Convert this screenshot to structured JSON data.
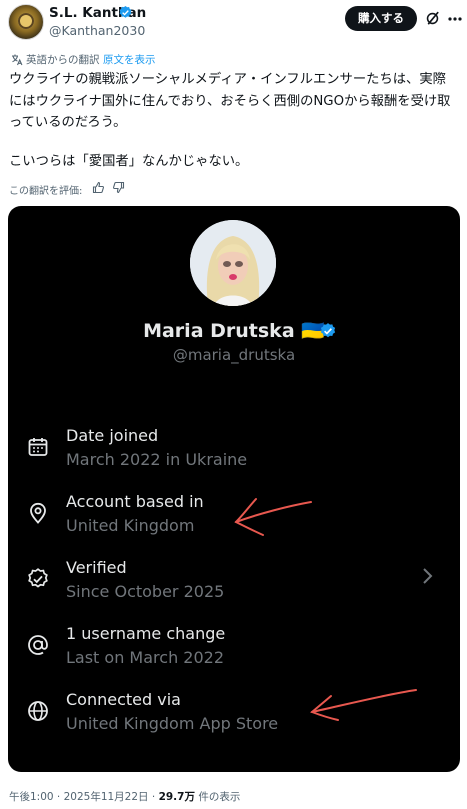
{
  "author": {
    "name": "S.L. Kanthan",
    "handle": "@Kanthan2030",
    "verified_color": "#1d9bf0"
  },
  "header": {
    "buy_label": "購入する",
    "icons": [
      "grok-icon",
      "more-icon"
    ]
  },
  "translation": {
    "label": "英語からの翻訳",
    "show_original": "原文を表示"
  },
  "tweet": {
    "text_line1": "ウクライナの親戦派ソーシャルメディア・インフルエンサーたちは、実際にはウクライナ国外に住んでおり、おそらく西側のNGOから報酬を受け取っているのだろう。",
    "text_line2": "こいつらは「愛国者」なんかじゃない。"
  },
  "rating": {
    "label": "この翻訳を評価:"
  },
  "media": {
    "profile_name": "Maria Drutska 🇺🇦",
    "profile_handle": "@maria_drutska",
    "rows": [
      {
        "title": "Date joined",
        "sub": "March 2022 in Ukraine",
        "icon": "calendar-icon"
      },
      {
        "title": "Account based in",
        "sub": "United Kingdom",
        "icon": "location-pin-icon"
      },
      {
        "title": "Verified",
        "sub": "Since October 2025",
        "icon": "verified-badge-icon"
      },
      {
        "title": "1 username change",
        "sub": "Last on March 2022",
        "icon": "at-sign-icon"
      },
      {
        "title": "Connected via",
        "sub": "United Kingdom App Store",
        "icon": "globe-icon"
      }
    ],
    "annotation_color": "#e8584f"
  },
  "footer": {
    "time_date": "午後1:00 · 2025年11月22日 · ",
    "views": "29.7万",
    "views_suffix": " 件の表示"
  }
}
